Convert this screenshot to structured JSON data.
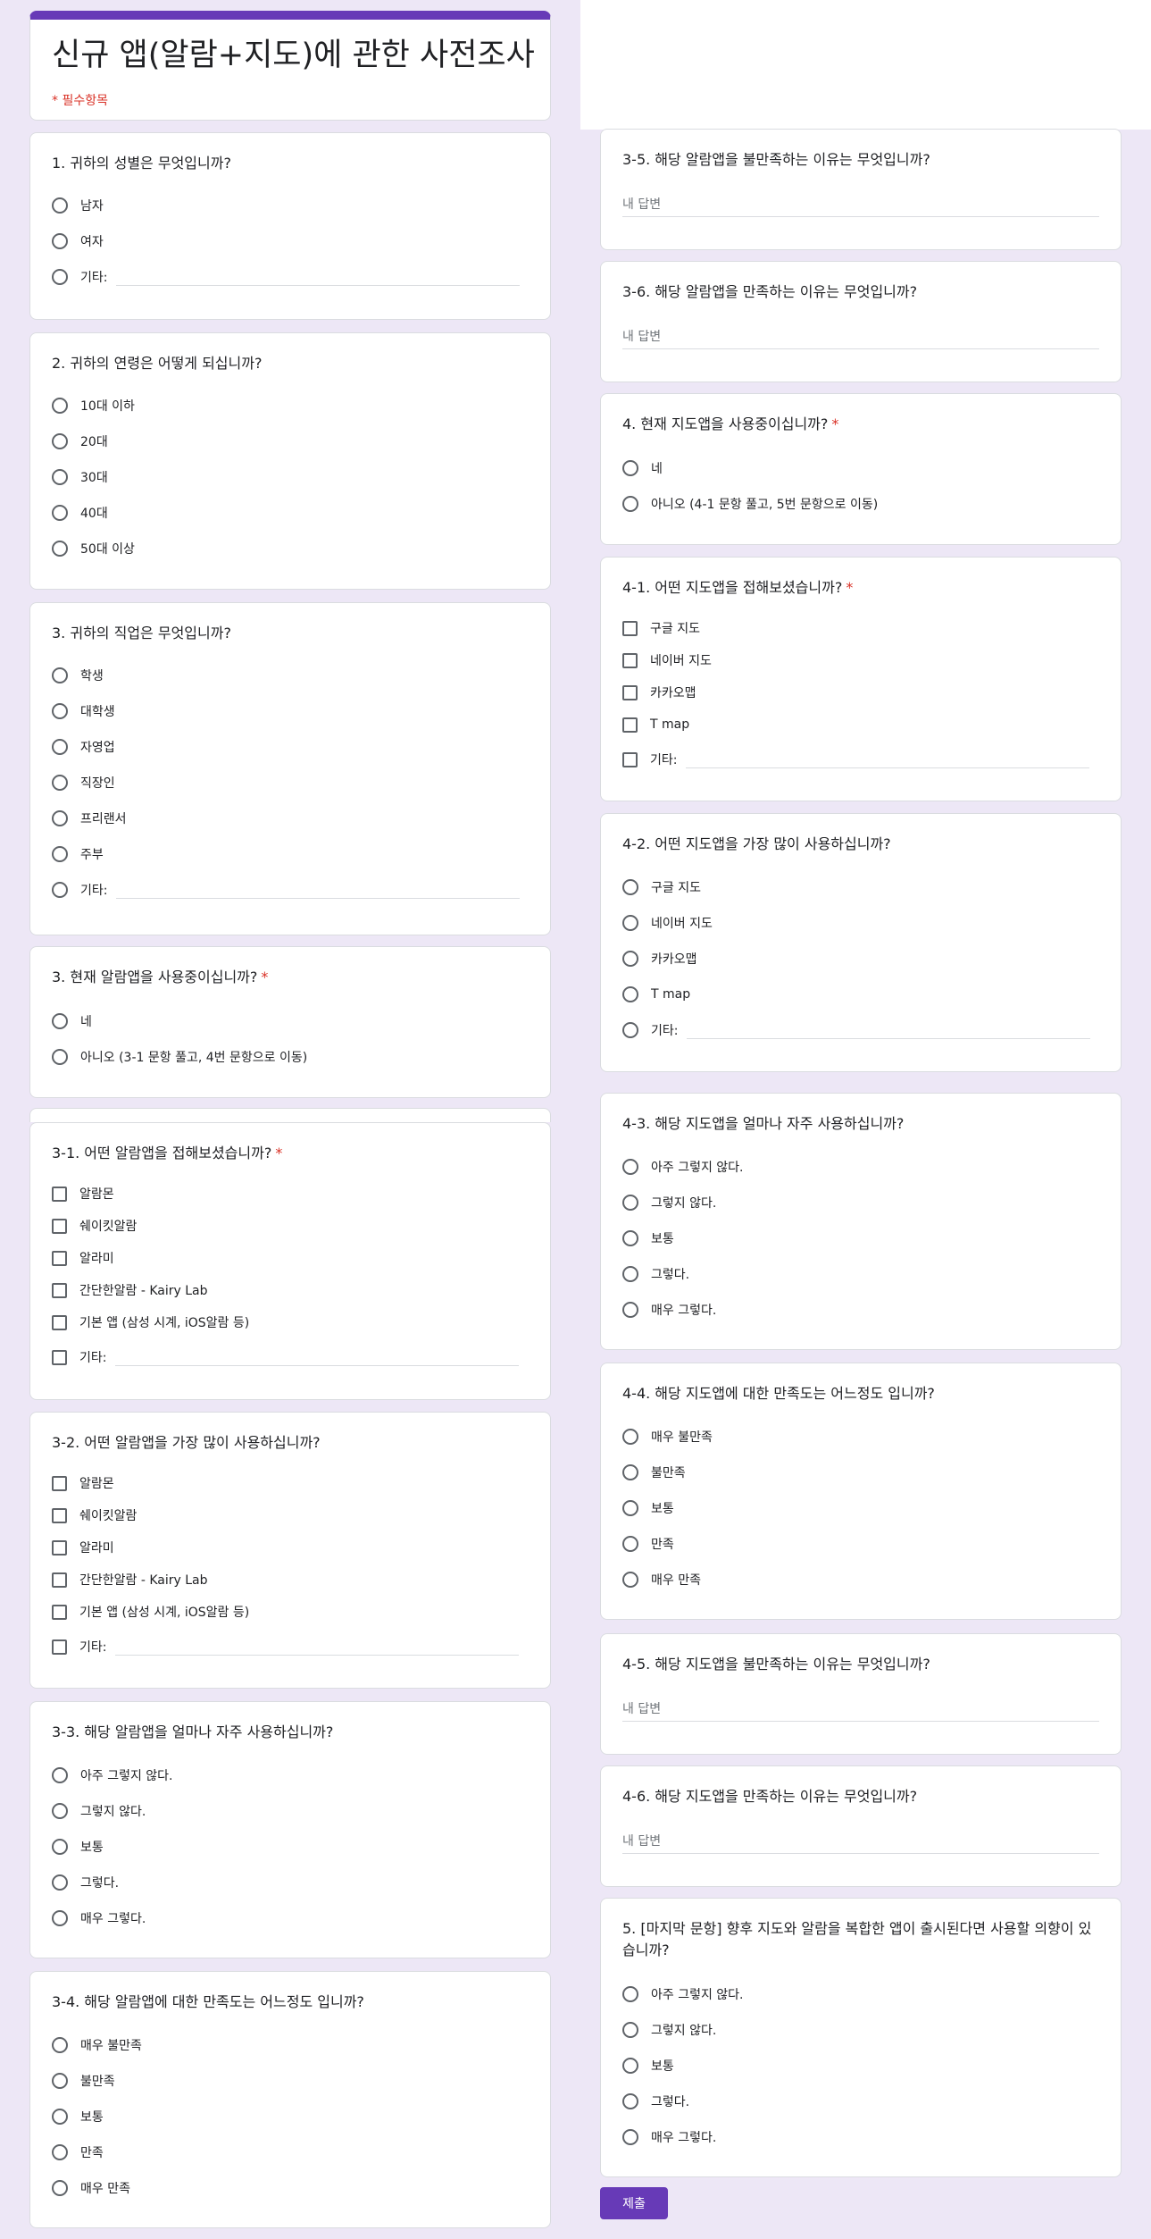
{
  "form": {
    "title": "신규 앱(알람+지도)에 관한 사전조사",
    "required_note": "* 필수항목",
    "submit_label": "제출",
    "answer_placeholder": "내 답변",
    "required_mark": "*"
  },
  "q_gender": {
    "title": "1. 귀하의 성별은 무엇입니까?",
    "options": [
      "남자",
      "여자",
      "기타:"
    ]
  },
  "q_age": {
    "title": "2. 귀하의 연령은 어떻게 되십니까?",
    "options": [
      "10대 이하",
      "20대",
      "30대",
      "40대",
      "50대 이상"
    ]
  },
  "q_job": {
    "title": "3. 귀하의 직업은 무엇입니까?",
    "options": [
      "학생",
      "대학생",
      "자영업",
      "직장인",
      "프리랜서",
      "주부",
      "기타:"
    ]
  },
  "q_alarm_use": {
    "title": "3. 현재 알람앱을 사용중이십니까?",
    "options": [
      "네",
      "아니오 (3-1 문항 풀고, 4번 문항으로 이동)"
    ]
  },
  "q_3_1": {
    "title": "3-1. 어떤 알람앱을 접해보셨습니까?",
    "options": [
      "알람몬",
      "쉐이킷알람",
      "알라미",
      "간단한알람 - Kairy Lab",
      "기본 앱 (삼성 시계, iOS알람 등)",
      "기타:"
    ]
  },
  "q_3_2": {
    "title": "3-2. 어떤 알람앱을 가장 많이 사용하십니까?",
    "options": [
      "알람몬",
      "쉐이킷알람",
      "알라미",
      "간단한알람 - Kairy Lab",
      "기본 앱 (삼성 시계, iOS알람 등)",
      "기타:"
    ]
  },
  "q_3_3": {
    "title": "3-3. 해당 알람앱을 얼마나 자주 사용하십니까?",
    "options": [
      "아주 그렇지 않다.",
      "그렇지 않다.",
      "보통",
      "그렇다.",
      "매우 그렇다."
    ]
  },
  "q_3_4": {
    "title": "3-4. 해당 알람앱에 대한 만족도는 어느정도 입니까?",
    "options": [
      "매우 불만족",
      "불만족",
      "보통",
      "만족",
      "매우 만족"
    ]
  },
  "q_3_5": {
    "title": "3-5. 해당 알람앱을 불만족하는 이유는 무엇입니까?"
  },
  "q_3_6": {
    "title": "3-6. 해당 알람앱을 만족하는 이유는 무엇입니까?"
  },
  "q_map_use": {
    "title": "4. 현재 지도앱을 사용중이십니까?",
    "options": [
      "네",
      "아니오 (4-1 문항 풀고, 5번 문항으로 이동)"
    ]
  },
  "q_4_1": {
    "title": "4-1. 어떤 지도앱을 접해보셨습니까?",
    "options": [
      "구글 지도",
      "네이버 지도",
      "카카오맵",
      "T map",
      "기타:"
    ]
  },
  "q_4_2": {
    "title": "4-2. 어떤 지도앱을 가장 많이 사용하십니까?",
    "options": [
      "구글 지도",
      "네이버 지도",
      "카카오맵",
      "T map",
      "기타:"
    ]
  },
  "q_4_3": {
    "title": "4-3. 해당 지도앱을 얼마나 자주 사용하십니까?",
    "options": [
      "아주 그렇지 않다.",
      "그렇지 않다.",
      "보통",
      "그렇다.",
      "매우 그렇다."
    ]
  },
  "q_4_4": {
    "title": "4-4. 해당 지도앱에 대한 만족도는 어느정도 입니까?",
    "options": [
      "매우 불만족",
      "불만족",
      "보통",
      "만족",
      "매우 만족"
    ]
  },
  "q_4_5": {
    "title": "4-5. 해당 지도앱을 불만족하는 이유는 무엇입니까?"
  },
  "q_4_6": {
    "title": "4-6. 해당 지도앱을 만족하는 이유는 무엇입니까?"
  },
  "q_5": {
    "title": "5. [마지막 문항] 향후 지도와 알람을 복합한 앱이 출시된다면 사용할 의향이 있습니까?",
    "options": [
      "아주 그렇지 않다.",
      "그렇지 않다.",
      "보통",
      "그렇다.",
      "매우 그렇다."
    ]
  }
}
